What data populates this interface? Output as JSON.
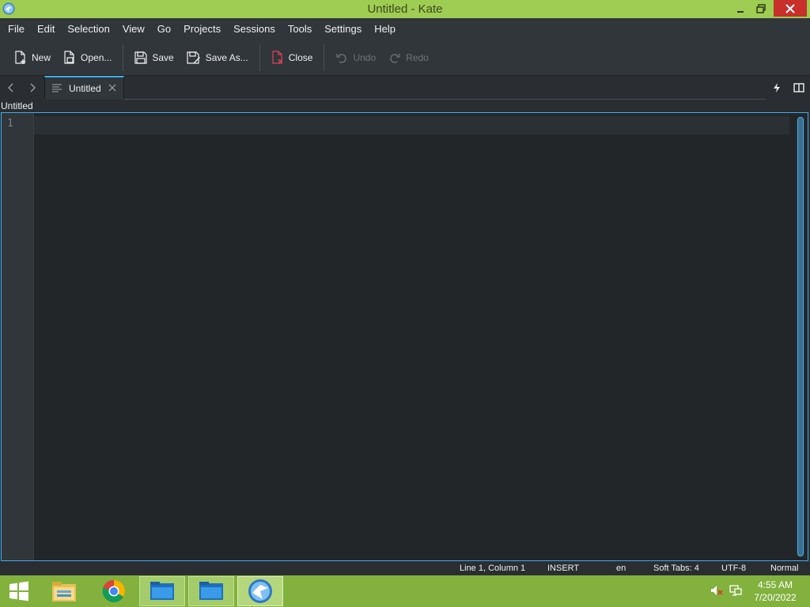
{
  "window": {
    "title": "Untitled  - Kate"
  },
  "menu": [
    "File",
    "Edit",
    "Selection",
    "View",
    "Go",
    "Projects",
    "Sessions",
    "Tools",
    "Settings",
    "Help"
  ],
  "toolbar": {
    "new": "New",
    "open": "Open...",
    "save": "Save",
    "save_as": "Save As...",
    "close": "Close",
    "undo": "Undo",
    "redo": "Redo"
  },
  "tabs": [
    {
      "label": "Untitled"
    }
  ],
  "document": {
    "label": "Untitled",
    "line_number": "1"
  },
  "status": {
    "position": "Line 1, Column 1",
    "mode": "INSERT",
    "language": "en",
    "indent": "Soft Tabs: 4",
    "encoding": "UTF-8",
    "highlight": "Normal"
  },
  "clock": {
    "time": "4:55 AM",
    "date": "7/20/2022"
  },
  "colors": {
    "titlebar": "#9fcc52",
    "accent": "#3daee9",
    "taskbar": "#82b13e",
    "close_button": "#c7302b"
  },
  "icons": {
    "start": "windows-logo-icon",
    "explorer": "file-explorer-icon",
    "chrome": "chrome-icon",
    "folder": "folder-icon",
    "kate": "kate-icon"
  }
}
